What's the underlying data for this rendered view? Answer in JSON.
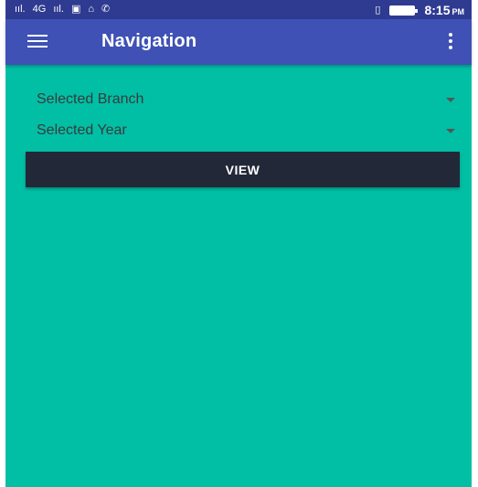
{
  "statusbar": {
    "signal_left": "ııl.",
    "network": "4G",
    "signal_right": "ııl.",
    "time": "8:15",
    "ampm": "PM"
  },
  "appbar": {
    "title": "Navigation",
    "menu_icon": "hamburger-menu-icon",
    "overflow_icon": "more-vertical-icon"
  },
  "form": {
    "branch_label": "Selected Branch",
    "year_label": "Selected Year",
    "view_label": "VIEW"
  },
  "colors": {
    "statusbar": "#2f3b91",
    "appbar": "#3f51b5",
    "background": "#00bfa5",
    "button": "#232838"
  }
}
